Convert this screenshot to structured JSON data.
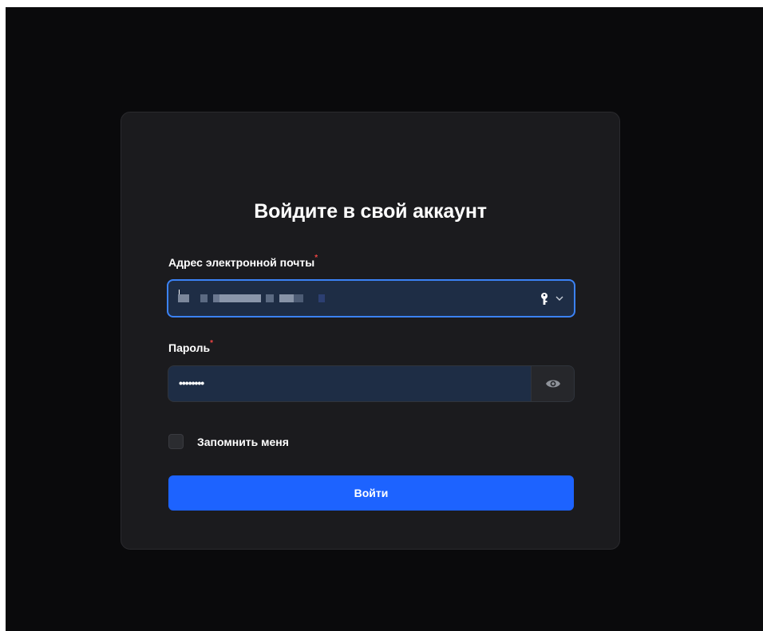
{
  "login": {
    "title": "Войдите в свой аккаунт",
    "email_label": "Адрес электронной почты",
    "password_label": "Пароль",
    "required_mark": "*",
    "password_value": "••••••••",
    "remember_label": "Запомнить меня",
    "remember_checked": false,
    "submit_label": "Войти"
  },
  "icons": {
    "email_autofill": "key-icon",
    "email_dropdown": "chevron-down-icon",
    "password_toggle": "eye-icon"
  },
  "colors": {
    "background": "#0a0a0c",
    "card": "#1b1b1e",
    "input_fill": "#1e2d45",
    "focus_border": "#3b82f6",
    "primary_button": "#1d63ff",
    "required": "#ef4444"
  }
}
